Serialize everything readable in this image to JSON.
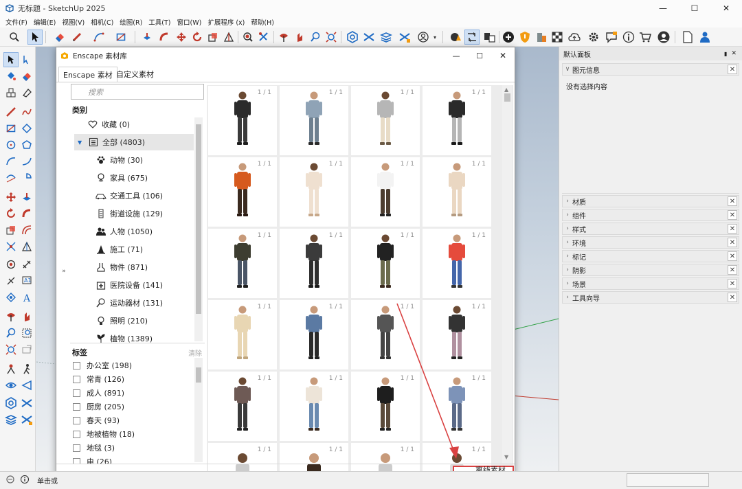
{
  "app": {
    "title": "无标题 - SketchUp 2025"
  },
  "menu": [
    "文件(F)",
    "编辑(E)",
    "视图(V)",
    "相机(C)",
    "绘图(R)",
    "工具(T)",
    "窗口(W)",
    "扩展程序 (x)",
    "帮助(H)"
  ],
  "toolbar_icons": [
    "search-icon",
    "select-arrow-icon",
    "eraser-icon",
    "pencil-icon",
    "arc-icon",
    "rectangle-icon",
    "push-pull-icon",
    "follow-me-icon",
    "move-icon",
    "rotate-icon",
    "scale-icon",
    "section-plane-icon",
    "paint-bucket-icon",
    "walk-icon",
    "orbit-icon",
    "pan-icon",
    "zoom-icon",
    "zoom-extents-icon",
    "enscape-icon",
    "user-icon",
    "settings-icon",
    "help-icon",
    "store-icon"
  ],
  "dialog": {
    "title": "Enscape 素材库",
    "tabs": [
      "Enscape 素材",
      "自定义素材"
    ],
    "search_placeholder": "搜索",
    "categories_header": "类别",
    "categories": [
      {
        "label": "收藏 (0)",
        "icon": "heart-icon"
      },
      {
        "label": "全部 (4803)",
        "icon": "list-icon"
      },
      {
        "label": "动物 (30)",
        "icon": "paw-icon"
      },
      {
        "label": "家具 (675)",
        "icon": "chair-icon"
      },
      {
        "label": "交通工具 (106)",
        "icon": "car-icon"
      },
      {
        "label": "街道设施 (129)",
        "icon": "street-light-icon"
      },
      {
        "label": "人物 (1050)",
        "icon": "people-icon"
      },
      {
        "label": "施工 (71)",
        "icon": "traffic-cone-icon"
      },
      {
        "label": "物件 (871)",
        "icon": "object-icon"
      },
      {
        "label": "医院设备 (141)",
        "icon": "medical-icon"
      },
      {
        "label": "运动器材 (131)",
        "icon": "sports-icon"
      },
      {
        "label": "照明 (210)",
        "icon": "bulb-icon"
      },
      {
        "label": "植物 (1389)",
        "icon": "plant-icon"
      }
    ],
    "tags_header": "标签",
    "clear_label": "清除",
    "tags": [
      "办公室 (198)",
      "常青 (126)",
      "成人 (891)",
      "厨房 (205)",
      "春天 (93)",
      "地被植物 (18)",
      "地毯 (3)",
      "电 (26)"
    ],
    "asset_count_label": "1 / 1",
    "offline_label": "离线素材库"
  },
  "panel": {
    "title": "默认面板",
    "entity_info": "图元信息",
    "no_selection": "没有选择内容",
    "sections": [
      "材质",
      "组件",
      "样式",
      "环境",
      "标记",
      "阴影",
      "场景",
      "工具向导"
    ]
  },
  "status": {
    "text": "单击或"
  },
  "colors": {
    "accent": "#0a64c8",
    "highlight_box": "#d94141",
    "axis_red": "#c0392b",
    "axis_green": "#2ea043"
  }
}
